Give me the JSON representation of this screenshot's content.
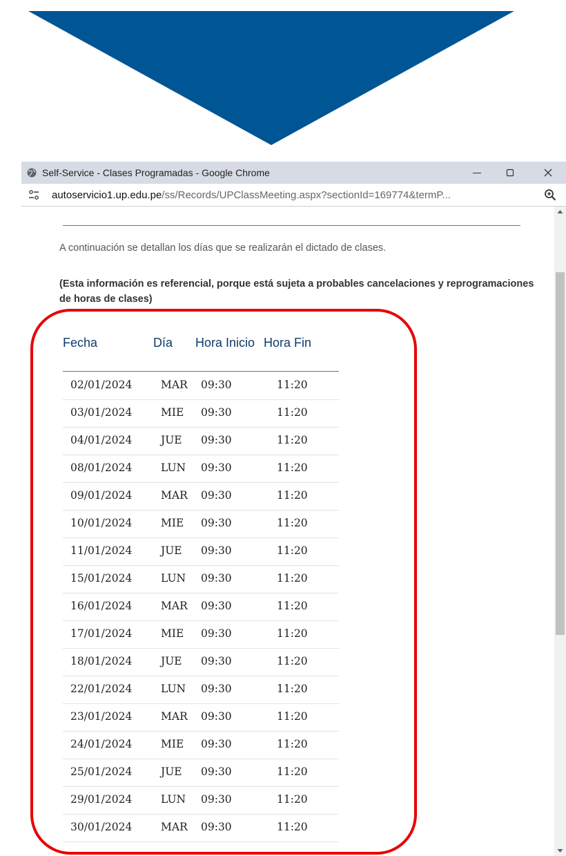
{
  "colors": {
    "arrow": "#005594",
    "highlight": "#e80000",
    "heading": "#0f3a6b",
    "rule": "#4a7ab3",
    "titlebar": "#d7dbe4"
  },
  "window": {
    "title": "Self-Service - Clases Programadas - Google Chrome",
    "minimize_icon": "minimize-icon",
    "maximize_icon": "maximize-icon",
    "close_icon": "close-icon"
  },
  "addressbar": {
    "url_host": "autoservicio1.up.edu.pe",
    "url_path": "/ss/Records/UPClassMeeting.aspx?sectionId=169774&termP...",
    "site_icon": "site-settings-icon",
    "zoom_icon": "zoom-icon"
  },
  "page": {
    "intro": "A continuación se detallan los días que se realizarán el dictado de clases.",
    "note": "(Esta información es referencial, porque está sujeta a probables cancelaciones y reprogramaciones de horas de clases)"
  },
  "table": {
    "headers": {
      "fecha": "Fecha",
      "dia": "Día",
      "hora_inicio": "Hora Inicio",
      "hora_fin": "Hora Fin"
    },
    "rows": [
      [
        "02/01/2024",
        "MAR",
        "09:30",
        "11:20"
      ],
      [
        "03/01/2024",
        "MIE",
        "09:30",
        "11:20"
      ],
      [
        "04/01/2024",
        "JUE",
        "09:30",
        "11:20"
      ],
      [
        "08/01/2024",
        "LUN",
        "09:30",
        "11:20"
      ],
      [
        "09/01/2024",
        "MAR",
        "09:30",
        "11:20"
      ],
      [
        "10/01/2024",
        "MIE",
        "09:30",
        "11:20"
      ],
      [
        "11/01/2024",
        "JUE",
        "09:30",
        "11:20"
      ],
      [
        "15/01/2024",
        "LUN",
        "09:30",
        "11:20"
      ],
      [
        "16/01/2024",
        "MAR",
        "09:30",
        "11:20"
      ],
      [
        "17/01/2024",
        "MIE",
        "09:30",
        "11:20"
      ],
      [
        "18/01/2024",
        "JUE",
        "09:30",
        "11:20"
      ],
      [
        "22/01/2024",
        "LUN",
        "09:30",
        "11:20"
      ],
      [
        "23/01/2024",
        "MAR",
        "09:30",
        "11:20"
      ],
      [
        "24/01/2024",
        "MIE",
        "09:30",
        "11:20"
      ],
      [
        "25/01/2024",
        "JUE",
        "09:30",
        "11:20"
      ],
      [
        "29/01/2024",
        "LUN",
        "09:30",
        "11:20"
      ],
      [
        "30/01/2024",
        "MAR",
        "09:30",
        "11:20"
      ]
    ]
  }
}
